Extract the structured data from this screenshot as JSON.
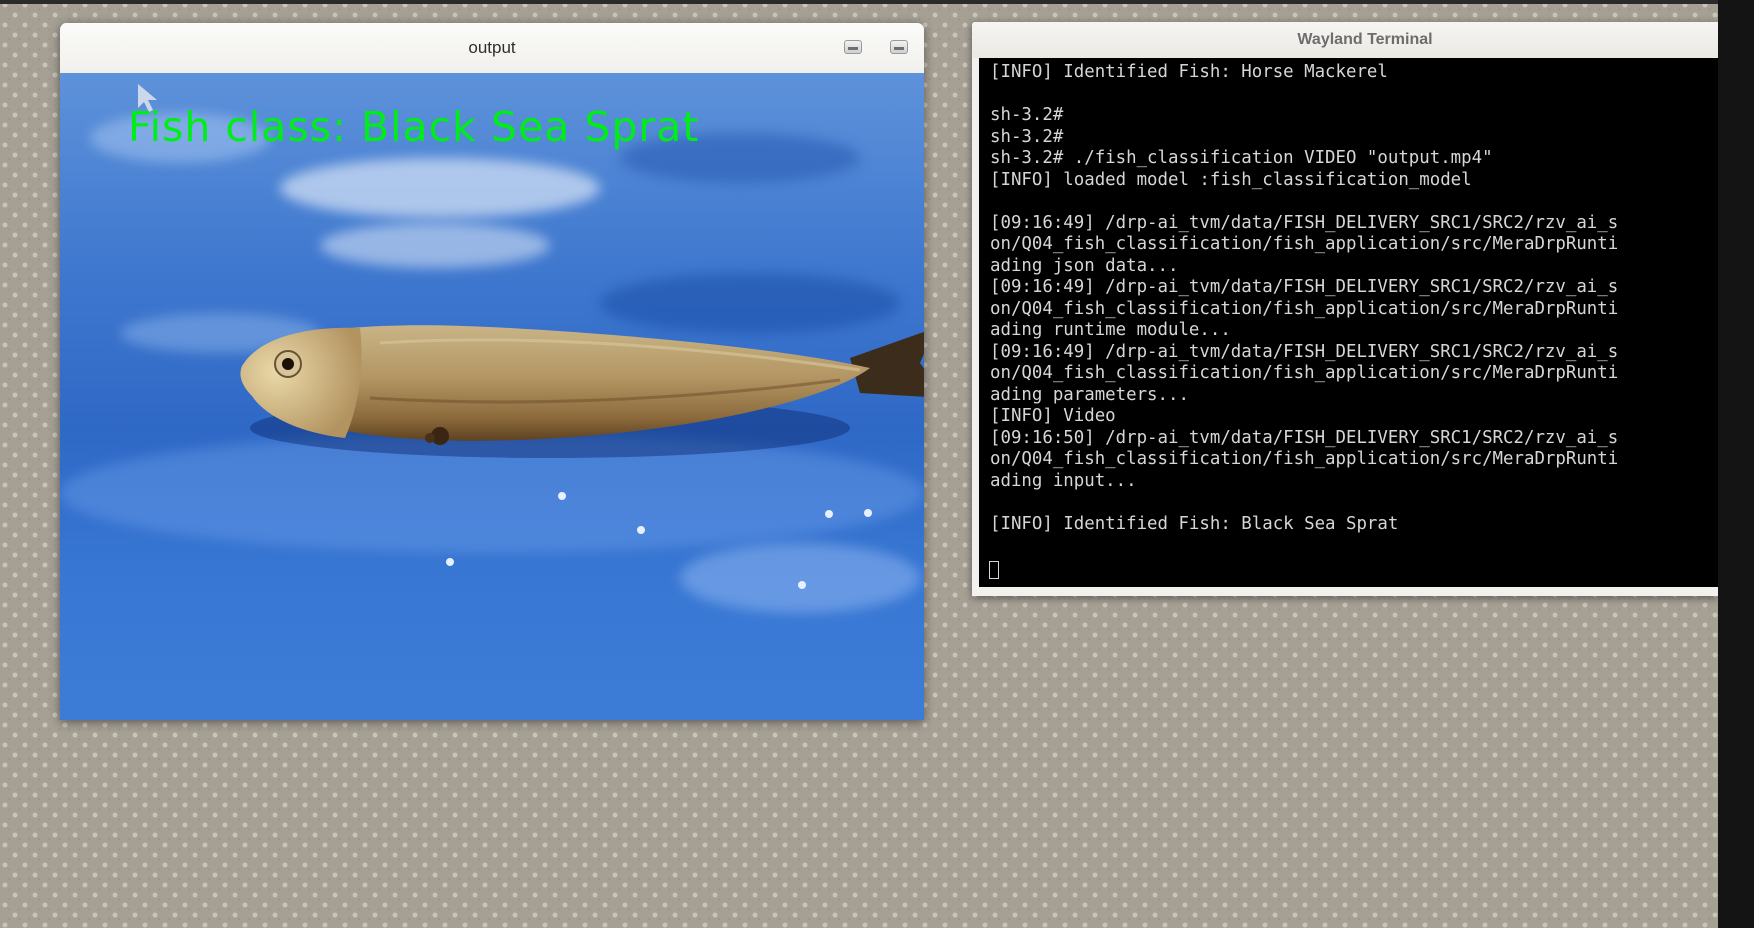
{
  "output_window": {
    "title": "output",
    "overlay_text": "Fish class: Black Sea Sprat"
  },
  "terminal_window": {
    "title": "Wayland Terminal",
    "lines": [
      "[INFO] Identified Fish: Horse Mackerel",
      "",
      "sh-3.2#",
      "sh-3.2#",
      "sh-3.2# ./fish_classification VIDEO \"output.mp4\"",
      "[INFO] loaded model :fish_classification_model",
      "",
      "[09:16:49] /drp-ai_tvm/data/FISH_DELIVERY_SRC1/SRC2/rzv_ai_s",
      "on/Q04_fish_classification/fish_application/src/MeraDrpRunti",
      "ading json data...",
      "[09:16:49] /drp-ai_tvm/data/FISH_DELIVERY_SRC1/SRC2/rzv_ai_s",
      "on/Q04_fish_classification/fish_application/src/MeraDrpRunti",
      "ading runtime module...",
      "[09:16:49] /drp-ai_tvm/data/FISH_DELIVERY_SRC1/SRC2/rzv_ai_s",
      "on/Q04_fish_classification/fish_application/src/MeraDrpRunti",
      "ading parameters...",
      "[INFO] Video",
      "[09:16:50] /drp-ai_tvm/data/FISH_DELIVERY_SRC1/SRC2/rzv_ai_s",
      "on/Q04_fish_classification/fish_application/src/MeraDrpRunti",
      "ading input...",
      "",
      "[INFO] Identified Fish: Black Sea Sprat"
    ]
  },
  "icons": {
    "minimize": "minimize-icon",
    "maximize": "maximize-icon",
    "pointer": "mouse-pointer-icon"
  },
  "colors": {
    "overlay_text": "#00ee18",
    "terminal_bg": "#000000",
    "terminal_fg": "#d6d6d6"
  }
}
